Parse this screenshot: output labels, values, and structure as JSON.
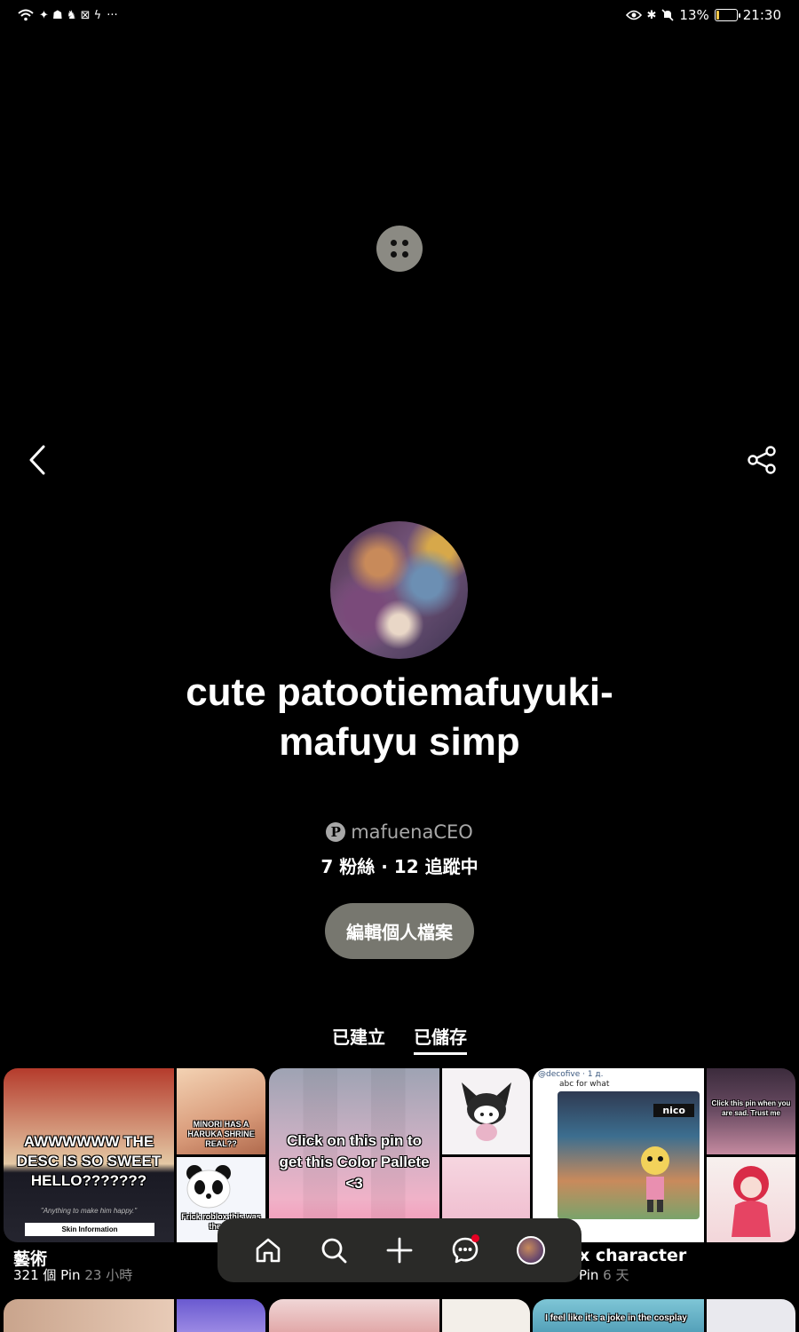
{
  "status_bar": {
    "left_icons": [
      "wifi-icon",
      "notification-icons"
    ],
    "more": "···",
    "battery_percent": "13%",
    "battery_level": 0.13,
    "time": "21:30"
  },
  "profile": {
    "name": "cute patootiemafuyuki-mafuyu simp",
    "username": "mafuenaCEO",
    "follow_stats": "7 粉絲 · 12 追蹤中",
    "edit_button": "編輯個人檔案"
  },
  "tabs": [
    {
      "label": "已建立",
      "active": false
    },
    {
      "label": "已儲存",
      "active": true
    }
  ],
  "boards": [
    {
      "title": "藝術",
      "count": "321 個 Pin",
      "time": "23 小時",
      "thumb_texts": {
        "main": "AWWWWWW THE DESC IS SO SWEET HELLO???????",
        "main_caption": "\"Anything to make him happy.\"",
        "main_footer": "Skin Information",
        "side_top": "MINORI HAS A HARUKA SHRINE REAL??",
        "side_bottom": "Frick roblox this was the og"
      }
    },
    {
      "title": "",
      "count": "",
      "time": "",
      "thumb_texts": {
        "main": "Click on this pin to get this Color Pallete <3"
      }
    },
    {
      "title": "x character",
      "count": "Pin",
      "time": "6 天",
      "thumb_texts": {
        "main_header": "@decofive · 1 д.",
        "main_sub": "abc for what",
        "main_name": "nico",
        "side_top": "Click this pin when you are sad. Trust me"
      }
    }
  ],
  "second_row_texts": {
    "board3": "I feel like it's a joke in the cosplay"
  },
  "bottom_nav": {
    "items": [
      "home-icon",
      "search-icon",
      "create-icon",
      "messages-icon",
      "profile-avatar"
    ]
  },
  "colors": {
    "background": "#000000",
    "button_gray": "#77776f",
    "nav_bg": "#2a2a28",
    "notification_red": "#e60023"
  }
}
